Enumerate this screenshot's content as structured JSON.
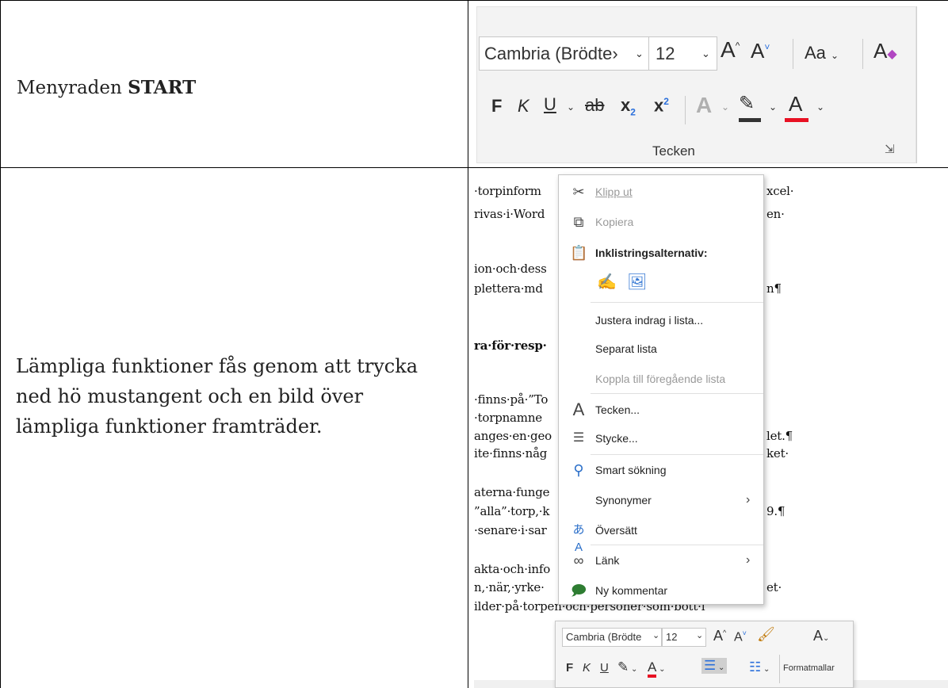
{
  "row1": {
    "label_prefix": "Menyraden ",
    "label_bold": "START"
  },
  "ribbon": {
    "font_name": "Cambria (Brödte›",
    "font_size": "12",
    "grow": "A",
    "shrink": "A",
    "change_case": "Aa",
    "bold": "F",
    "italic": "K",
    "underline": "U",
    "strike": "ab",
    "subscript": "x",
    "superscript": "x",
    "text_effects": "A",
    "font_color": "A",
    "group_label": "Tecken",
    "font_color_hex": "#e81123",
    "highlight_hex": "#333333"
  },
  "row2": {
    "label": "Lämpliga funktioner fås genom att trycka ned hö mustangent och en bild över lämpliga funktioner framträder."
  },
  "doc": {
    "lines": [
      "·torpinform",
      "rivas·i·Word",
      "ion·och·dess",
      "plettera·md",
      "ra·för·resp·",
      "·finns·på·”To",
      "·torpnamne",
      "anges·en·geo",
      "ite·finns·någ",
      "aterna·funge",
      "”alla”·torp,·k",
      "·senare·i·sar",
      "akta·och·info",
      "n,·när,·yrke·",
      "ilder·på·torpen·och·personer·som·bott·i"
    ],
    "right_fragments": [
      "xcel·",
      "en·",
      "n¶",
      "let.¶",
      "ket·",
      "9.¶",
      "et·"
    ]
  },
  "context_menu": {
    "items": [
      {
        "label": "Klipp ut",
        "icon": "scissors-icon",
        "disabled": true
      },
      {
        "label": "Kopiera",
        "icon": "copy-icon",
        "disabled": true
      },
      {
        "label": "Inklistringsalternativ:",
        "icon": "paste-icon",
        "disabled": false
      },
      {
        "label": "Justera indrag i lista...",
        "icon": "",
        "disabled": false
      },
      {
        "label": "Separat lista",
        "icon": "",
        "disabled": false
      },
      {
        "label": "Koppla till föregående lista",
        "icon": "",
        "disabled": true
      },
      {
        "label": "Tecken...",
        "icon": "font-icon",
        "disabled": false
      },
      {
        "label": "Stycke...",
        "icon": "paragraph-icon",
        "disabled": false
      },
      {
        "label": "Smart sökning",
        "icon": "smart-lookup-icon",
        "disabled": false
      },
      {
        "label": "Synonymer",
        "icon": "",
        "disabled": false
      },
      {
        "label": "Översätt",
        "icon": "translate-icon",
        "disabled": false
      },
      {
        "label": "Länk",
        "icon": "link-icon",
        "disabled": false
      },
      {
        "label": "Ny kommentar",
        "icon": "comment-icon",
        "disabled": false
      }
    ]
  },
  "mini_toolbar": {
    "font_name": "Cambria (Brödte",
    "font_size": "12",
    "grow": "A",
    "shrink": "A",
    "bold": "F",
    "italic": "K",
    "underline": "U",
    "font_color": "A",
    "styles_label": "Formatmallar"
  }
}
